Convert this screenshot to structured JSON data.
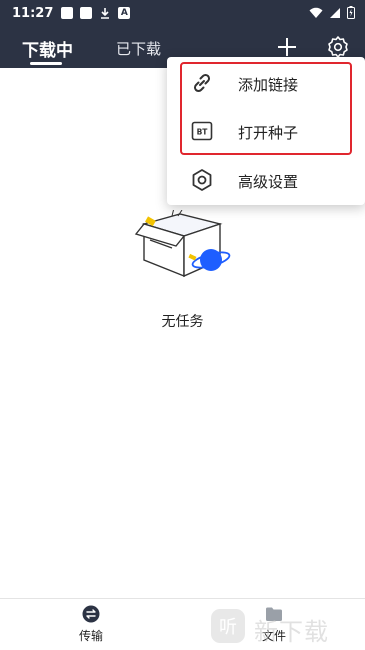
{
  "status_bar": {
    "time": "11:27",
    "app_icon_letter": "A"
  },
  "tabs": [
    {
      "label": "下载中",
      "active": true
    },
    {
      "label": "已下载",
      "active": false
    }
  ],
  "menu": {
    "items": [
      {
        "label": "添加链接",
        "icon": "link-icon"
      },
      {
        "label": "打开种子",
        "icon": "bt-icon"
      },
      {
        "label": "高级设置",
        "icon": "hexagon-settings-icon"
      }
    ],
    "bt_badge_text": "BT",
    "highlight_color": "#e0262e"
  },
  "empty_state": {
    "text": "无任务"
  },
  "bottom_nav": [
    {
      "label": "传输",
      "icon": "transfer-icon"
    },
    {
      "label": "文件",
      "icon": "folder-icon"
    }
  ],
  "watermark": {
    "logo_text": "听",
    "text": "新下载"
  },
  "colors": {
    "header_bg": "#2c3344",
    "accent_blue": "#1e5eff",
    "accent_yellow": "#f2c200"
  }
}
